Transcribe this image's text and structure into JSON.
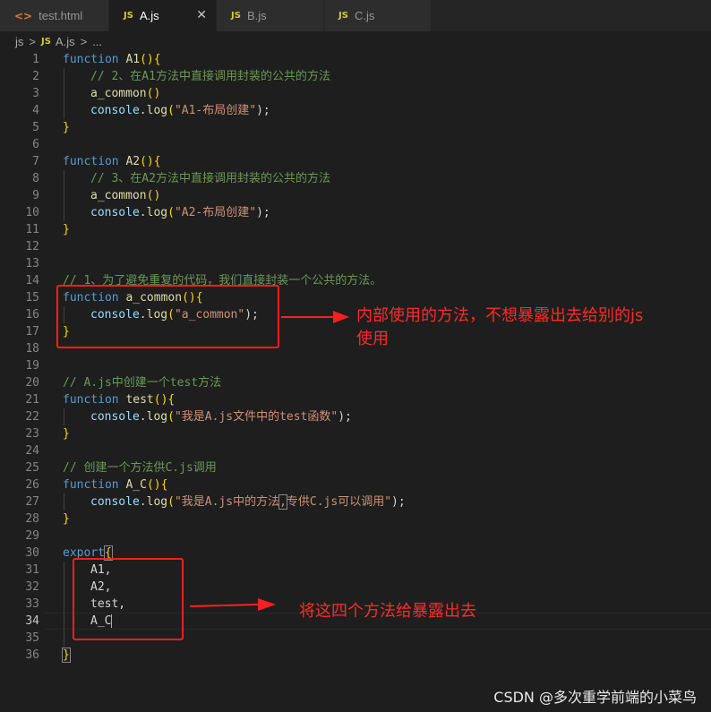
{
  "tabs": [
    {
      "icon": "<>",
      "label": "test.html"
    },
    {
      "icon": "JS",
      "label": "A.js",
      "close": "✕"
    },
    {
      "icon": "JS",
      "label": "B.js"
    },
    {
      "icon": "JS",
      "label": "C.js"
    }
  ],
  "breadcrumb": {
    "folder": "js",
    "sep": ">",
    "file_icon": "JS",
    "file": "A.js",
    "more": "..."
  },
  "colors": {
    "keyword": "#569cd6",
    "function": "#dcdcaa",
    "string": "#ce9178",
    "comment": "#6a9955",
    "annotation": "#ff1e1e"
  },
  "code": {
    "l1": {
      "kw": "function",
      "name": "A1",
      "rest": "(){"
    },
    "l2": {
      "text": "// 2、在A1方法中直接调用封装的公共的方法"
    },
    "l3": {
      "name": "a_common",
      "rest": "()"
    },
    "l4": {
      "obj": "console",
      "meth": "log",
      "str": "\"A1-布局创建\"",
      "end": ");"
    },
    "l5": {
      "text": "}"
    },
    "l7": {
      "kw": "function",
      "name": "A2",
      "rest": "(){"
    },
    "l8": {
      "text": "// 3、在A2方法中直接调用封装的公共的方法"
    },
    "l9": {
      "name": "a_common",
      "rest": "()"
    },
    "l10": {
      "obj": "console",
      "meth": "log",
      "str": "\"A2-布局创建\"",
      "end": ");"
    },
    "l11": {
      "text": "}"
    },
    "l14": {
      "text": "// 1、为了避免重复的代码，我们直接封装一个公共的方法。"
    },
    "l15": {
      "kw": "function",
      "name": "a_common",
      "rest": "(){"
    },
    "l16": {
      "obj": "console",
      "meth": "log",
      "str": "\"a_common\"",
      "end": ");"
    },
    "l17": {
      "text": "}"
    },
    "l20": {
      "text": "// A.js中创建一个test方法"
    },
    "l21": {
      "kw": "function",
      "name": "test",
      "rest": "(){"
    },
    "l22": {
      "obj": "console",
      "meth": "log",
      "str": "\"我是A.js文件中的test函数\"",
      "end": ");"
    },
    "l23": {
      "text": "}"
    },
    "l25": {
      "text": "// 创建一个方法供C.js调用"
    },
    "l26": {
      "kw": "function",
      "name": "A_C",
      "rest": "(){"
    },
    "l27": {
      "obj": "console",
      "meth": "log",
      "str_a": "\"我是A.js中的方法",
      "str_hl": ",",
      "str_b": "专供C.js可以调用\"",
      "end": ");"
    },
    "l28": {
      "text": "}"
    },
    "l30": {
      "kw": "export",
      "rest": "{"
    },
    "l31": {
      "text": "A1,"
    },
    "l32": {
      "text": "A2,"
    },
    "l33": {
      "text": "test,"
    },
    "l34": {
      "text": "A_C"
    },
    "l36": {
      "text": "}"
    }
  },
  "line_numbers": [
    "1",
    "2",
    "3",
    "4",
    "5",
    "6",
    "7",
    "8",
    "9",
    "10",
    "11",
    "12",
    "13",
    "14",
    "15",
    "16",
    "17",
    "18",
    "19",
    "20",
    "21",
    "22",
    "23",
    "24",
    "25",
    "26",
    "27",
    "28",
    "29",
    "30",
    "31",
    "32",
    "33",
    "34",
    "35",
    "36"
  ],
  "annotations": {
    "note1_line1": "内部使用的方法，不想暴露出去给别的js",
    "note1_line2": "使用",
    "note2": "将这四个方法给暴露出去"
  },
  "watermark": "CSDN @多次重学前端的小菜鸟"
}
